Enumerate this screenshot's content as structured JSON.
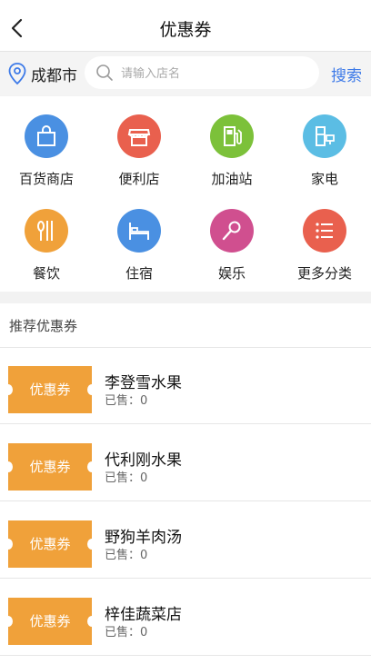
{
  "header": {
    "title": "优惠券",
    "back_icon": "back-chevron-icon"
  },
  "search": {
    "city": "成都市",
    "placeholder": "请输入店名",
    "button": "搜索"
  },
  "categories": [
    {
      "label": "百货商店",
      "icon": "shopping-bag-icon",
      "color": "#4a90e2"
    },
    {
      "label": "便利店",
      "icon": "storefront-icon",
      "color": "#e9604e"
    },
    {
      "label": "加油站",
      "icon": "gas-pump-icon",
      "color": "#7cc13a"
    },
    {
      "label": "家电",
      "icon": "appliance-icon",
      "color": "#5bbde4"
    },
    {
      "label": "餐饮",
      "icon": "utensils-icon",
      "color": "#f0a13a"
    },
    {
      "label": "住宿",
      "icon": "bed-icon",
      "color": "#4a90e2"
    },
    {
      "label": "娱乐",
      "icon": "microphone-icon",
      "color": "#d04f8f"
    },
    {
      "label": "更多分类",
      "icon": "list-icon",
      "color": "#e9604e"
    }
  ],
  "section": {
    "title": "推荐优惠券"
  },
  "coupons": [
    {
      "badge": "优惠券",
      "store": "李登雪水果",
      "sold": "已售：0"
    },
    {
      "badge": "优惠券",
      "store": "代利刚水果",
      "sold": "已售：0"
    },
    {
      "badge": "优惠券",
      "store": "野狗羊肉汤",
      "sold": "已售：0"
    },
    {
      "badge": "优惠券",
      "store": "梓佳蔬菜店",
      "sold": "已售：0"
    }
  ]
}
